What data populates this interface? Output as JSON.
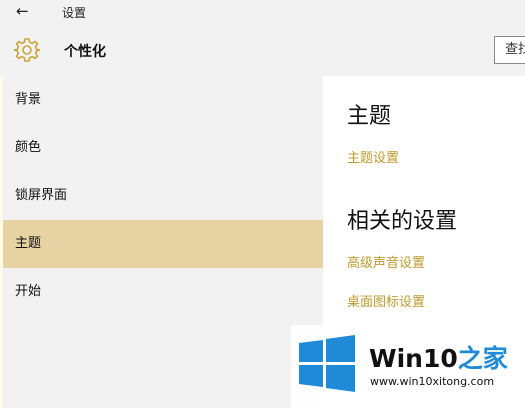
{
  "window": {
    "title": "设置",
    "back_icon": "back-arrow-icon"
  },
  "header": {
    "icon": "gear-icon",
    "title": "个性化",
    "search_placeholder": "查找设置"
  },
  "sidebar": {
    "items": [
      {
        "label": "背景",
        "active": false
      },
      {
        "label": "颜色",
        "active": false
      },
      {
        "label": "锁屏界面",
        "active": false
      },
      {
        "label": "主题",
        "active": true
      },
      {
        "label": "开始",
        "active": false
      }
    ]
  },
  "main": {
    "section1_title": "主题",
    "section1_link": "主题设置",
    "section2_title": "相关的设置",
    "related_links": [
      "高级声音设置",
      "桌面图标设置"
    ]
  },
  "watermark": {
    "brand_prefix": "Win10",
    "brand_suffix": "之家",
    "url": "www.win10xitong.com",
    "icon": "windows-logo-icon"
  },
  "colors": {
    "accent": "#bf9a2e",
    "active_item": "#e6d2a2",
    "sidebar_bg": "#f2f2f2",
    "logo_blue": "#1e8ad8"
  }
}
